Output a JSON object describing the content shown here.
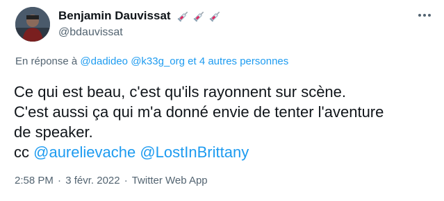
{
  "author": {
    "name": "Benjamin Dauvissat",
    "handle": "@bdauvissat",
    "name_emojis": [
      "syringe-icon",
      "syringe-icon",
      "syringe-icon"
    ]
  },
  "reply": {
    "prefix": "En réponse à",
    "mentions": [
      "@dadideo",
      "@k33g_org"
    ],
    "others": "et 4 autres personnes"
  },
  "body": {
    "lines": [
      "Ce qui est beau, c'est qu'ils rayonnent sur scène.",
      "C'est aussi ça qui m'a donné envie de tenter l'aventure",
      "de speaker."
    ],
    "cc_prefix": "cc",
    "cc_mentions": [
      "@aurelievache",
      "@LostInBrittany"
    ]
  },
  "meta": {
    "time": "2:58 PM",
    "separator": "·",
    "date": "3 févr. 2022",
    "source": "Twitter Web App"
  },
  "colors": {
    "text": "#0f1419",
    "secondary": "#536471",
    "link": "#1d9bf0"
  }
}
